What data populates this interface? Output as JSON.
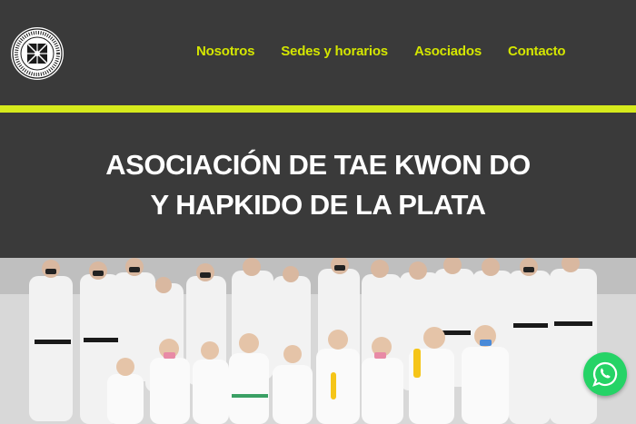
{
  "header": {
    "logo_text": "ASOCIACIÓN DE TAE KWON DO DEL DISTRITO DE LA PLATA",
    "nav": [
      {
        "label": "Nosotros"
      },
      {
        "label": "Sedes y horarios"
      },
      {
        "label": "Asociados"
      },
      {
        "label": "Contacto"
      }
    ]
  },
  "hero": {
    "title": "ASOCIACIÓN DE TAE KWON DO Y HAPKIDO DE LA PLATA"
  },
  "photo": {
    "description_icon": "group-photo"
  },
  "colors": {
    "accent": "#d6ea1c",
    "nav_text": "#d4e600",
    "background": "#3a3a3a",
    "whatsapp": "#25d366"
  },
  "whatsapp": {
    "icon": "whatsapp-icon"
  }
}
